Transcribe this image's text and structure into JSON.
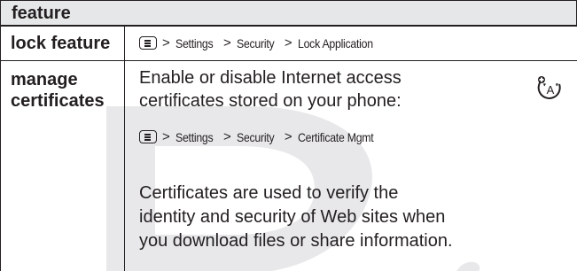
{
  "table": {
    "header": "feature",
    "rows": [
      {
        "feature": "lock feature",
        "path": [
          "Settings",
          "Security",
          "Lock Application"
        ]
      },
      {
        "feature_line1": "manage",
        "feature_line2": "certificates",
        "desc1_line1": "Enable or disable Internet access",
        "desc1_line2": "certificates stored on your phone:",
        "path": [
          "Settings",
          "Security",
          "Certificate Mgmt"
        ],
        "desc2_line1": "Certificates are used to verify the",
        "desc2_line2": "identity and security of Web sites when",
        "desc2_line3": "you download files or share information.",
        "icon": "network-feature-icon"
      }
    ]
  },
  "path_separator": ">",
  "icons": {
    "menu_key": "menu-key-icon",
    "watermark": "draft-watermark"
  },
  "colors": {
    "header_bg": "#e6e7e8",
    "text": "#231f20",
    "watermark": "#e8e8ea"
  }
}
